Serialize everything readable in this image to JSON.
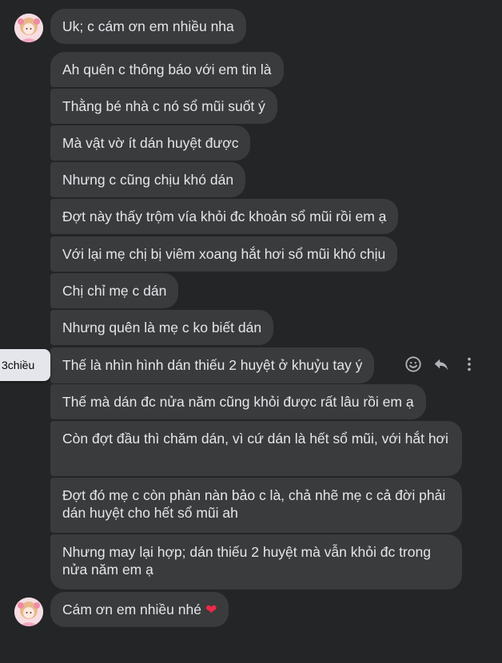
{
  "messages": [
    {
      "text": "Uk; c cám ơn em nhiều nha"
    },
    {
      "text": "Ah quên c thông báo với em tin là"
    },
    {
      "text": "Thằng bé nhà c nó sổ mũi suốt ý"
    },
    {
      "text": "Mà vật vờ ít dán huyệt được"
    },
    {
      "text": "Nhưng c cũng chịu khó dán"
    },
    {
      "text": "Đợt này thấy trộm vía khỏi đc khoản sổ mũi rồi em ạ"
    },
    {
      "text": "Với lại mẹ chị bị viêm xoang hắt hơi sổ mũi khó chịu"
    },
    {
      "text": "Chị chỉ mẹ c dán"
    },
    {
      "text": "Nhưng quên là mẹ c ko biết dán"
    },
    {
      "text": "Thế là nhìn hình dán thiếu 2 huyệt ở khuỷu tay ý"
    },
    {
      "text": "Thế mà dán đc nửa năm cũng khỏi được rất lâu rồi em ạ"
    },
    {
      "text": "Còn đợt đầu thì chăm dán, vì cứ dán là hết sổ mũi, với hắt hơi"
    },
    {
      "text": "Đợt đó mẹ c còn phàn nàn bảo c là, chả nhẽ mẹ c cả đời phải dán huyệt cho hết sổ mũi ah"
    },
    {
      "text": "Nhưng may lại hợp; dán thiếu 2 huyệt mà vẫn khỏi đc trong nửa năm em ạ"
    },
    {
      "text": "Cám ơn em nhiều nhé",
      "emoji": "❤"
    }
  ],
  "hover_timestamp": "3chiều",
  "actions": [
    {
      "icon": "smiley-react-icon"
    },
    {
      "icon": "reply-icon"
    },
    {
      "icon": "more-options-icon"
    }
  ],
  "colors": {
    "background": "#242526",
    "bubble": "#3a3b3c",
    "text": "#e4e6eb",
    "icon": "#b0b3b8",
    "heart": "#f02849"
  }
}
